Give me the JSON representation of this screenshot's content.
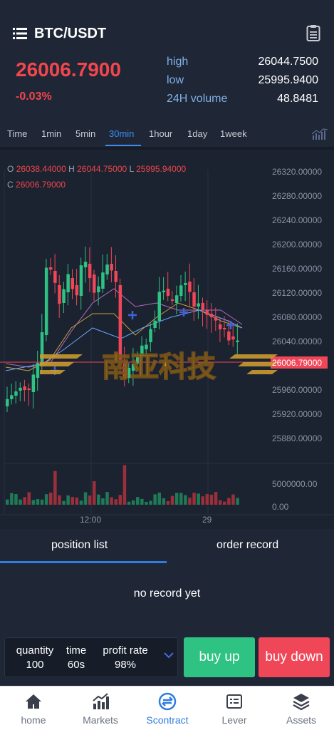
{
  "header": {
    "pair": "BTC/USDT",
    "menu_icon": "list-icon",
    "doc_icon": "clipboard-icon"
  },
  "ticker": {
    "price": "26006.7900",
    "change": "-0.03%",
    "stats": [
      {
        "label": "high",
        "value": "26044.7500"
      },
      {
        "label": "low",
        "value": "25995.9400"
      },
      {
        "label": "24H volume",
        "value": "48.8481"
      }
    ]
  },
  "timeframes": [
    "Time",
    "1min",
    "5min",
    "30min",
    "1hour",
    "1day",
    "1week"
  ],
  "active_timeframe": "30min",
  "chart": {
    "ohlc": {
      "o_label": "O",
      "o": "26038.44000",
      "h_label": "H",
      "h": "26044.75000",
      "l_label": "L",
      "l": "25995.94000",
      "c_label": "C",
      "c": "26006.79000"
    },
    "y_ticks": [
      "26320.00000",
      "26280.00000",
      "26240.00000",
      "26200.00000",
      "26160.00000",
      "26120.00000",
      "26080.00000",
      "26040.00000",
      "25960.00000",
      "25920.00000",
      "25880.00000"
    ],
    "current_price_tag": "26006.79000",
    "volume_ticks": [
      "5000000.00",
      "0.00"
    ],
    "x_ticks": [
      "12:00",
      "29"
    ],
    "watermark": "南亚科技"
  },
  "tabs": {
    "position": "position list",
    "order": "order record"
  },
  "empty_text": "no record yet",
  "order": {
    "quantity_label": "quantity",
    "quantity": "100",
    "time_label": "time",
    "time": "60s",
    "profit_label": "profit rate",
    "profit": "98%",
    "buy_up": "buy up",
    "buy_down": "buy down"
  },
  "nav": [
    {
      "label": "home",
      "icon": "home-icon"
    },
    {
      "label": "Markets",
      "icon": "markets-chart-icon"
    },
    {
      "label": "Scontract",
      "icon": "contract-icon",
      "active": true
    },
    {
      "label": "Lever",
      "icon": "lever-card-icon"
    },
    {
      "label": "Assets",
      "icon": "layers-icon"
    }
  ],
  "colors": {
    "up": "#2ec383",
    "down": "#ef4758",
    "accent": "#2f7de1",
    "background": "#1f2636"
  }
}
